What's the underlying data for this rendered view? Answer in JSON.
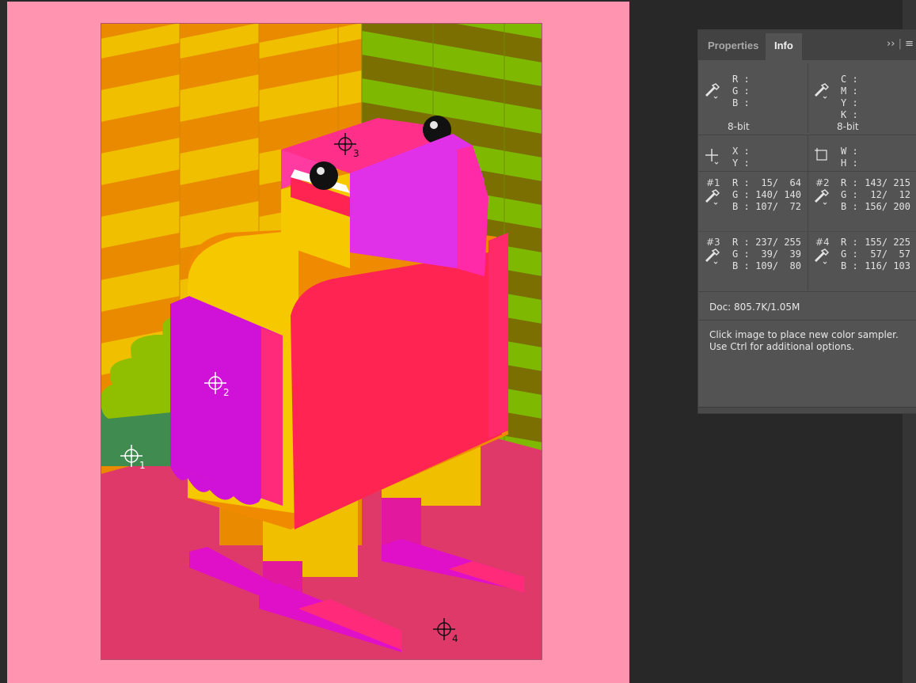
{
  "panel": {
    "tabs": [
      {
        "label": "Properties",
        "active": false
      },
      {
        "label": "Info",
        "active": true
      }
    ],
    "menu_icons": [
      "expand-panel-icon",
      "panel-menu-icon"
    ],
    "readout": {
      "rgb": {
        "labels": "R :\nG :\nB :",
        "bit_depth": "8-bit"
      },
      "cmyk": {
        "labels": "C :\nM :\nY :\nK :",
        "bit_depth": "8-bit"
      },
      "xy": {
        "labels": "X :\nY :"
      },
      "wh": {
        "labels": "W :\nH :"
      }
    },
    "samplers": [
      {
        "tag": "#1",
        "labels": "R :\nG :\nB :",
        "values": "15/  64\n140/ 140\n107/  72"
      },
      {
        "tag": "#2",
        "labels": "R :\nG :\nB :",
        "values": "143/ 215\n12/  12\n156/ 200"
      },
      {
        "tag": "#3",
        "labels": "R :\nG :\nB :",
        "values": "237/ 255\n39/  39\n109/  80"
      },
      {
        "tag": "#4",
        "labels": "R :\nG :\nB :",
        "values": "155/ 225\n57/  57\n116/ 103"
      }
    ],
    "doc_size": "Doc: 805.7K/1.05M",
    "hint": "Click image to place new color sampler.  Use Ctrl for additional options."
  },
  "canvas": {
    "background_color": "#fe94b0",
    "sampler_markers": [
      {
        "number": "1",
        "color": "#ffffff"
      },
      {
        "number": "2",
        "color": "#ffffff"
      },
      {
        "number": "3",
        "color": "#111111"
      },
      {
        "number": "4",
        "color": "#111111"
      }
    ]
  },
  "colors": {
    "workspace": "#282828",
    "panel": "#535353",
    "tab_bar": "#424242"
  }
}
